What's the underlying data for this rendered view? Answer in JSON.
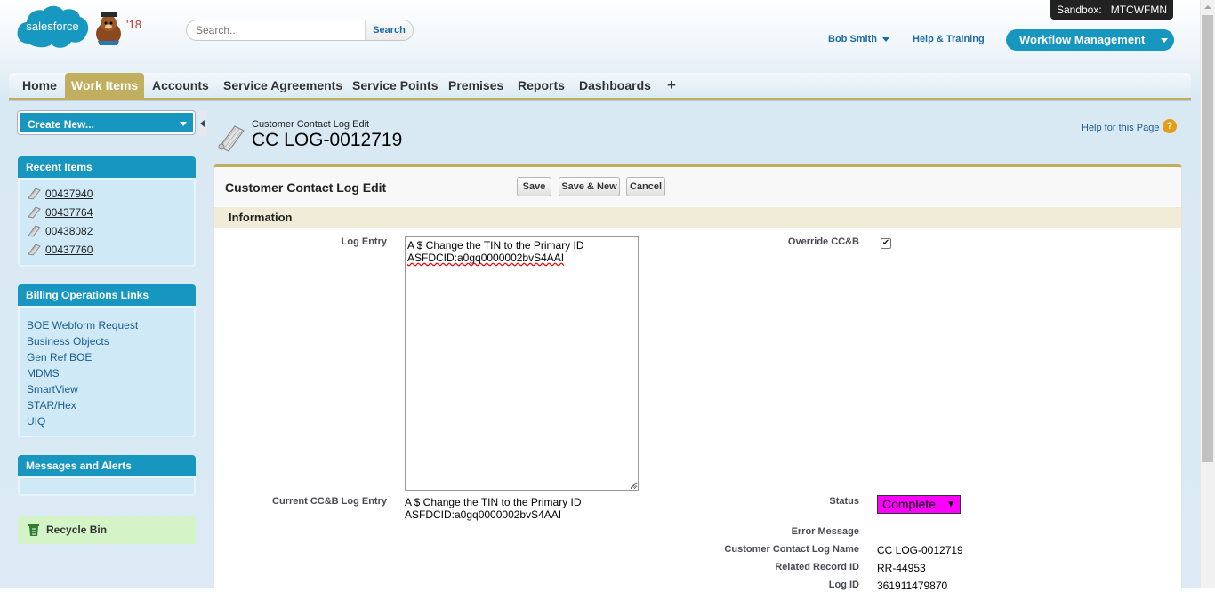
{
  "header": {
    "logo_text": "salesforce",
    "mascot_badge": "'18",
    "search_placeholder": "Search...",
    "search_button": "Search",
    "sandbox_label": "Sandbox:",
    "sandbox_name": "MTCWFMN",
    "user_name": "Bob Smith",
    "help_training": "Help & Training",
    "app_name": "Workflow Management"
  },
  "tabs": [
    {
      "label": "Home"
    },
    {
      "label": "Work Items",
      "active": true
    },
    {
      "label": "Accounts"
    },
    {
      "label": "Service Agreements"
    },
    {
      "label": "Service Points"
    },
    {
      "label": "Premises"
    },
    {
      "label": "Reports"
    },
    {
      "label": "Dashboards"
    },
    {
      "label": "+"
    }
  ],
  "sidebar": {
    "create_new": "Create New...",
    "recent_title": "Recent Items",
    "recent_items": [
      "00437940",
      "00437764",
      "00438082",
      "00437760"
    ],
    "billing_title": "Billing Operations Links",
    "billing_links": [
      "BOE Webform Request",
      "Business Objects",
      "Gen Ref BOE",
      "MDMS",
      "SmartView",
      "STAR/Hex",
      "UIQ"
    ],
    "messages_title": "Messages and Alerts",
    "recycle_bin": "Recycle Bin"
  },
  "page": {
    "subtitle": "Customer Contact Log Edit",
    "title": "CC LOG-0012719",
    "help_link": "Help for this Page",
    "help_icon_glyph": "?"
  },
  "form": {
    "panel_title": "Customer Contact Log Edit",
    "buttons": {
      "save": "Save",
      "save_new": "Save & New",
      "cancel": "Cancel"
    },
    "section_title": "Information",
    "log_entry_label": "Log Entry",
    "log_entry_line1": "A $ Change the TIN to the Primary ID",
    "log_entry_line2": "ASFDCID:a0gq0000002bvS4AAI",
    "override_label": "Override CC&B",
    "override_checked": true,
    "current_label": "Current CC&B Log Entry",
    "current_line1": "A $ Change the TIN to the Primary ID",
    "current_line2": "ASFDCID:a0gq0000002bvS4AAI",
    "status_label": "Status",
    "status_value": "Complete",
    "status_color": "#ff00ff",
    "error_label": "Error Message",
    "error_value": "",
    "name_label": "Customer Contact Log Name",
    "name_value": "CC LOG-0012719",
    "related_label": "Related Record ID",
    "related_value": "RR-44953",
    "logid_label": "Log ID",
    "logid_value": "361911479870"
  },
  "colors": {
    "accent_blue": "#1797c0",
    "tab_gold": "#c1ae5f",
    "sidebar_bg": "#cfeaf6",
    "recycle_bg": "#d4f4c8"
  }
}
